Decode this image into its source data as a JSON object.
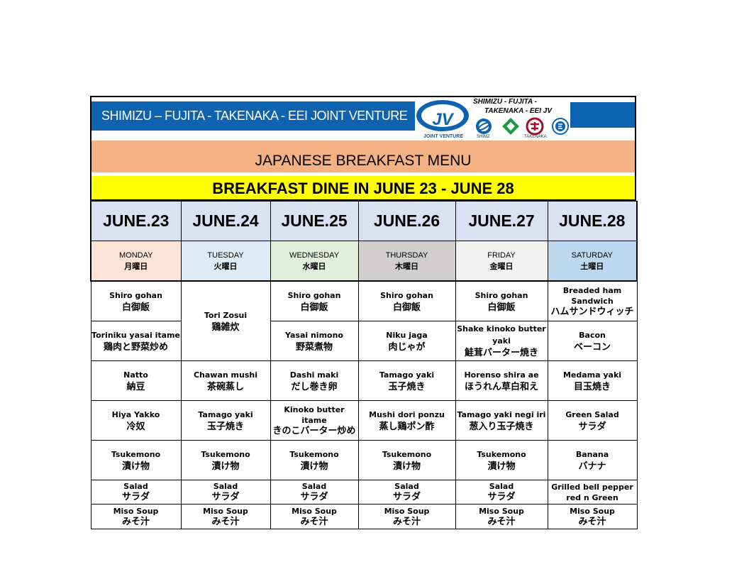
{
  "header": {
    "company": "SHIMIZU – FUJITA - TAKENAKA - EEI  JOINT VENTURE",
    "logo_mark": "JV",
    "logo_caption": "JOINT VENTURE",
    "logo_names_line1": "SHIMIZU - FUJITA -",
    "logo_names_line2": "TAKENAKA - EEI  JV",
    "mini_caption_shimz": "SHIMZ",
    "mini_caption_takenaka": "TAKENAKA",
    "menu_title": "JAPANESE BREAKFAST  MENU",
    "period": "BREAKFAST DINE IN JUNE 23 - JUNE 28"
  },
  "colors": {
    "brand_blue": "#0e63b0",
    "title_band": "#f4b183",
    "period_band": "#ffff00",
    "date_row": "#d9e1f2",
    "monday": "#fce4d6",
    "tuesday": "#ddebf7",
    "wednesday": "#e2efda",
    "thursday": "#d0cece",
    "friday": "#f2f2f2",
    "saturday": "#bdd7ee"
  },
  "icons": [
    "jv-logo",
    "shimizu-logo",
    "fujita-logo",
    "takenaka-logo",
    "eei-logo"
  ],
  "days": [
    {
      "date": "JUNE.23",
      "day_en": "MONDAY",
      "day_jp": "月曜日"
    },
    {
      "date": "JUNE.24",
      "day_en": "TUESDAY",
      "day_jp": "火曜日"
    },
    {
      "date": "JUNE.25",
      "day_en": "WEDNESDAY",
      "day_jp": "水曜日"
    },
    {
      "date": "JUNE.26",
      "day_en": "THURSDAY",
      "day_jp": "木曜日"
    },
    {
      "date": "JUNE.27",
      "day_en": "FRIDAY",
      "day_jp": "金曜日"
    },
    {
      "date": "JUNE.28",
      "day_en": "SATURDAY",
      "day_jp": "土曜日"
    }
  ],
  "menu": {
    "mon": [
      {
        "en": "Shiro gohan",
        "jp": "白御飯"
      },
      {
        "en": "Toriniku yasai itame",
        "jp": "鶏肉と野菜炒め"
      },
      {
        "en": "Natto",
        "jp": "納豆"
      },
      {
        "en": "Hiya Yakko",
        "jp": "冷奴"
      },
      {
        "en": "Tsukemono",
        "jp": "漬け物"
      },
      {
        "en": "Salad",
        "jp": "サラダ"
      },
      {
        "en": "Miso Soup",
        "jp": "みそ汁"
      }
    ],
    "tue": [
      {
        "en": "Tori Zosui",
        "jp": "鶏雑炊"
      },
      {
        "en": "Chawan mushi",
        "jp": "茶碗蒸し"
      },
      {
        "en": "Tamago yaki",
        "jp": "玉子焼き"
      },
      {
        "en": "Tsukemono",
        "jp": "漬け物"
      },
      {
        "en": "Salad",
        "jp": "サラダ"
      },
      {
        "en": "Miso Soup",
        "jp": "みそ汁"
      }
    ],
    "wed": [
      {
        "en": "Shiro gohan",
        "jp": "白御飯"
      },
      {
        "en": "Yasai nimono",
        "jp": "野菜煮物"
      },
      {
        "en": "Dashi maki",
        "jp": "だし巻き卵"
      },
      {
        "en": "Kinoko butter itame",
        "jp": "きのこバーター炒め"
      },
      {
        "en": "Tsukemono",
        "jp": "漬け物"
      },
      {
        "en": "Salad",
        "jp": "サラダ"
      },
      {
        "en": "Miso Soup",
        "jp": "みそ汁"
      }
    ],
    "thu": [
      {
        "en": "Shiro gohan",
        "jp": "白御飯"
      },
      {
        "en": "Niku jaga",
        "jp": "肉じゃが"
      },
      {
        "en": "Tamago yaki",
        "jp": "玉子焼き"
      },
      {
        "en": "Mushi dori ponzu",
        "jp": "蒸し鶏ポン酢"
      },
      {
        "en": "Tsukemono",
        "jp": "漬け物"
      },
      {
        "en": "Salad",
        "jp": "サラダ"
      },
      {
        "en": "Miso Soup",
        "jp": "みそ汁"
      }
    ],
    "fri": [
      {
        "en": "Shiro gohan",
        "jp": "白御飯"
      },
      {
        "en": "Shake kinoko butter yaki",
        "jp": "鮭茸バーター焼き"
      },
      {
        "en": "Horenso shira ae",
        "jp": "ほうれん草白和え"
      },
      {
        "en": "Tamago yaki negi iri",
        "jp": "葱入り玉子焼き"
      },
      {
        "en": "Tsukemono",
        "jp": "漬け物"
      },
      {
        "en": "Salad",
        "jp": "サラダ"
      },
      {
        "en": "Miso Soup",
        "jp": "みそ汁"
      }
    ],
    "sat": [
      {
        "en": "Breaded ham Sandwich",
        "jp": "ハムサンドウィッチ"
      },
      {
        "en": "Bacon",
        "jp": "ベーコン"
      },
      {
        "en": "Medama yaki",
        "jp": "目玉焼き"
      },
      {
        "en": "Green Salad",
        "jp": "サラダ"
      },
      {
        "en": "Banana",
        "jp": "バナナ"
      },
      {
        "en": "Grilled bell pepper red n Green",
        "jp": ""
      },
      {
        "en": "Miso Soup",
        "jp": "みそ汁"
      }
    ]
  }
}
